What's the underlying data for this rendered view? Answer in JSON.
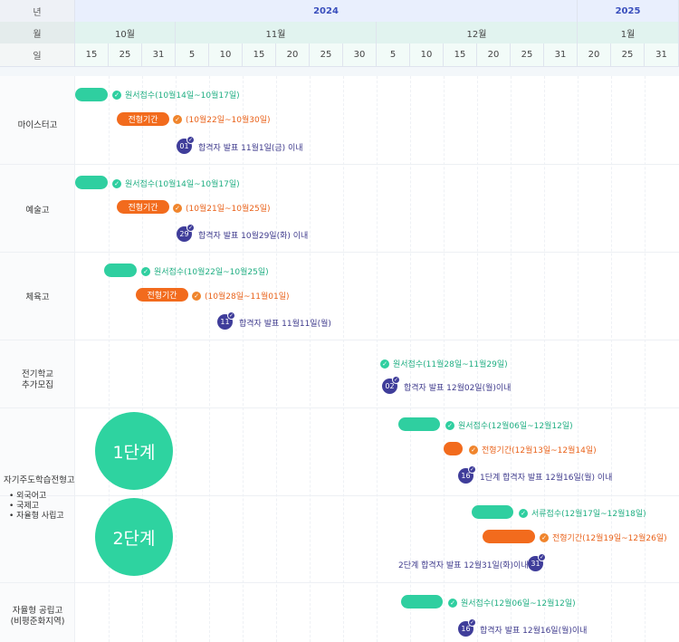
{
  "header": {
    "row_labels": {
      "year": "년",
      "month": "월",
      "day": "일"
    },
    "years": [
      "2024",
      "2025"
    ],
    "months": [
      "10월",
      "11월",
      "12월",
      "1월"
    ],
    "days": [
      "15",
      "25",
      "31",
      "5",
      "10",
      "15",
      "20",
      "25",
      "30",
      "5",
      "10",
      "15",
      "20",
      "25",
      "31",
      "20",
      "25",
      "31"
    ]
  },
  "rows": {
    "meister": {
      "label": "마이스터고",
      "apply": "원서접수(10월14일~10월17일)",
      "screen_bar": "전형기간",
      "screen": "(10월22일~10월30일)",
      "badge": "01",
      "result": "합격자 발표 11월1일(금) 이내"
    },
    "arts": {
      "label": "예술고",
      "apply": "원서접수(10월14일~10월17일)",
      "screen_bar": "전형기간",
      "screen": "(10월21일~10월25일)",
      "badge": "29",
      "result": "합격자 발표 10월29일(화) 이내"
    },
    "sports": {
      "label": "체육고",
      "apply": "원서접수(10월22일~10월25일)",
      "screen_bar": "전형기간",
      "screen": "(10월28일~11월01일)",
      "badge": "11",
      "result": "합격자 발표 11월11일(월)"
    },
    "early": {
      "label_line1": "전기학교",
      "label_line2": "추가모집",
      "apply": "원서접수(11월28일~11월29일)",
      "badge": "02",
      "result": "합격자 발표 12월02일(월)이내"
    },
    "self": {
      "label": "자기주도학습전형고",
      "bullets": [
        "외국어고",
        "국제고",
        "자율형 사립고"
      ],
      "stage1": "1단계",
      "stage1_apply": "원서접수(12월06일~12월12일)",
      "stage1_screen": "전형기간(12월13일~12월14일)",
      "stage1_badge": "16",
      "stage1_result": "1단계 합격자 발표 12월16일(월) 이내",
      "stage2": "2단계",
      "stage2_docs": "서류접수(12월17일~12월18일)",
      "stage2_screen": "전형기간(12월19일~12월26일)",
      "stage2_badge": "31",
      "stage2_result": "2단계 합격자 발표 12월31일(화)이내"
    },
    "public": {
      "label_line1": "자율형 공립고",
      "label_line2": "(비평준화지역)",
      "apply": "원서접수(12월06일~12월12일)",
      "badge": "16",
      "result": "합격자 발표 12월16일(월)이내"
    }
  },
  "colors": {
    "green": "#2fcfa0",
    "orange": "#f26b1d",
    "purple": "#3f3d9a",
    "year_text": "#3a4fbd"
  },
  "icons": {
    "check": "check-circle-icon"
  }
}
